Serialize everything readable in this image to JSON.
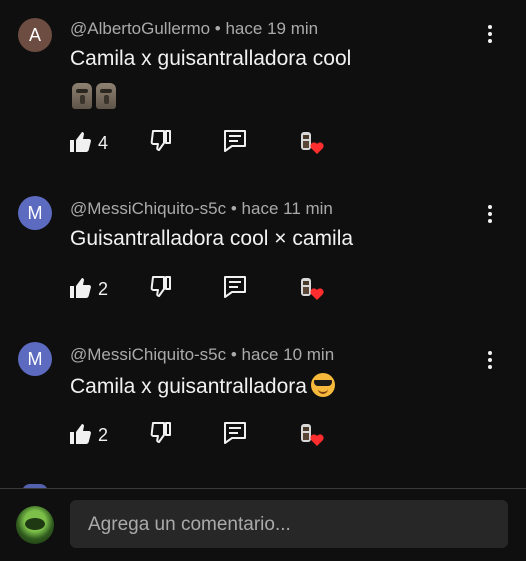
{
  "comments": [
    {
      "avatar_letter": "A",
      "avatar_color": "#6d4c41",
      "meta": "@AlbertoGullermo • hace 19 min",
      "text": "Camila x guisantralladora cool",
      "emojis": [
        "moai",
        "moai"
      ],
      "likes": "4"
    },
    {
      "avatar_letter": "M",
      "avatar_color": "#5c6bc0",
      "meta": "@MessiChiquito-s5c • hace 11 min",
      "text": "Guisantralladora cool × camila",
      "likes": "2"
    },
    {
      "avatar_letter": "M",
      "avatar_color": "#5c6bc0",
      "meta": "@MessiChiquito-s5c • hace 10 min",
      "text": "Camila x guisantralladora",
      "trailing_emoji": "smiling-face-with-sunglasses",
      "likes": "2"
    }
  ],
  "footer": {
    "placeholder": "Agrega un comentario..."
  }
}
